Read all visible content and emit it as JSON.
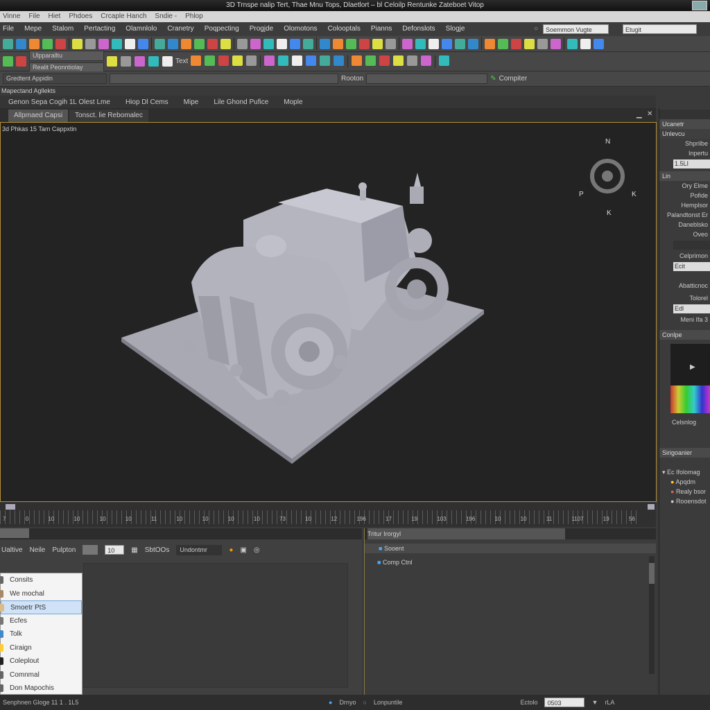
{
  "window": {
    "title": "3D Trnspe nalip Tert, Thae Mnu Tops, Dlaetlort – bl Celoilp Rentunke Zateboet Vitop"
  },
  "menu_primary": [
    "Vinne",
    "File",
    "Hiet",
    "Phdoes",
    "Crcaple Hanch",
    "Sndie -",
    "Phlop"
  ],
  "menu_secondary": [
    "File",
    "Mepe",
    "Stalom",
    "Pertacting",
    "Olamnlolo",
    "Cranetry",
    "Poqpecting",
    "Progjde",
    "Olomotons",
    "Colooptals",
    "Pianns",
    "Defonslots",
    "Slogje"
  ],
  "search": {
    "value": "Soemmon Vugte",
    "field2": "Etugit"
  },
  "toolbar": {
    "combo1": "Ulpparalltu",
    "combo2": "Realit Peonntiolay",
    "text_label": "Text",
    "dropdown_label": "Rooton",
    "complete_label": "Compiter",
    "left_combo": "Gredtent Appidin"
  },
  "section_label": "Mapectand Agllekts",
  "links": [
    "Genon Sepa Cogih 1L Olest Lme",
    "Hiop Dl Cems",
    "Mipe",
    "Lile Ghond Pufice",
    "Mople"
  ],
  "tabs": [
    {
      "label": "Allpmaed Capsi",
      "active": true
    },
    {
      "label": "Tonsct. lie Rebomalec",
      "active": false
    }
  ],
  "viewport": {
    "label": "3d Phkas 15 Tam Cappxtin",
    "compass": {
      "n": "N",
      "w": "P",
      "e": "K",
      "s": "K"
    }
  },
  "right_panel": {
    "header": "Ucanetr",
    "group1": "Unlevcu",
    "items1": [
      "Shprilbe",
      "Inpertu"
    ],
    "field1": "1.5LI",
    "group2": "Lin",
    "items2": [
      "Ory Elme",
      "Pofide",
      "Hemplsor",
      "Palandtonst Er",
      "Daneblsko",
      "Oveo"
    ],
    "label_a": "Celprimon",
    "field_a": "Ecit",
    "label_b": "Abatticnoc",
    "label_c": "Tolorel",
    "field_b": "Edl",
    "label_d": "Meni Ifa 3",
    "color_header": "Conlpe",
    "color_label": "Celsnlog",
    "scene_header": "Sirigoanier",
    "scene_root": "Ec Ifolomag",
    "scene_items": [
      "Apqdm",
      "Realy bsor",
      "Rooensdot"
    ]
  },
  "timeline": {
    "ticks": [
      "7",
      "0",
      "10",
      "10",
      "10",
      "10",
      "11",
      "10",
      "10",
      "10",
      "10",
      "73",
      "10",
      "12",
      "196",
      "17",
      "19",
      "103",
      "196",
      "10",
      "10",
      "11",
      "1107",
      "19",
      "56"
    ]
  },
  "bottom_left": {
    "toolbar": [
      "Ualtive",
      "Neile",
      "Pulpton"
    ],
    "frame": "10",
    "status": "SbtOOs",
    "mode": "Undontmr"
  },
  "popup_menu": {
    "items": [
      "Consits",
      "We mochal",
      "Smoetr PtS",
      "Ecfes",
      "Tolk",
      "Ciraign",
      "Coleplout",
      "Comnmal",
      "Don Mapochis"
    ],
    "selected": 2
  },
  "bottom_right": {
    "header": "Tritur Irorgyl",
    "tree": [
      "Sooent",
      "Comp Ctnl"
    ]
  },
  "status_bar": {
    "left": "Senphnen Gloge 11 1 . 1L5",
    "items": [
      "Drnyo",
      "Lonpuntile",
      "Ectolo"
    ],
    "value": "0503",
    "zoom": "rLA"
  },
  "colors": {
    "accent_border": "#b39036",
    "viewport_bg": "#232323",
    "model": "#b9b9c4"
  }
}
